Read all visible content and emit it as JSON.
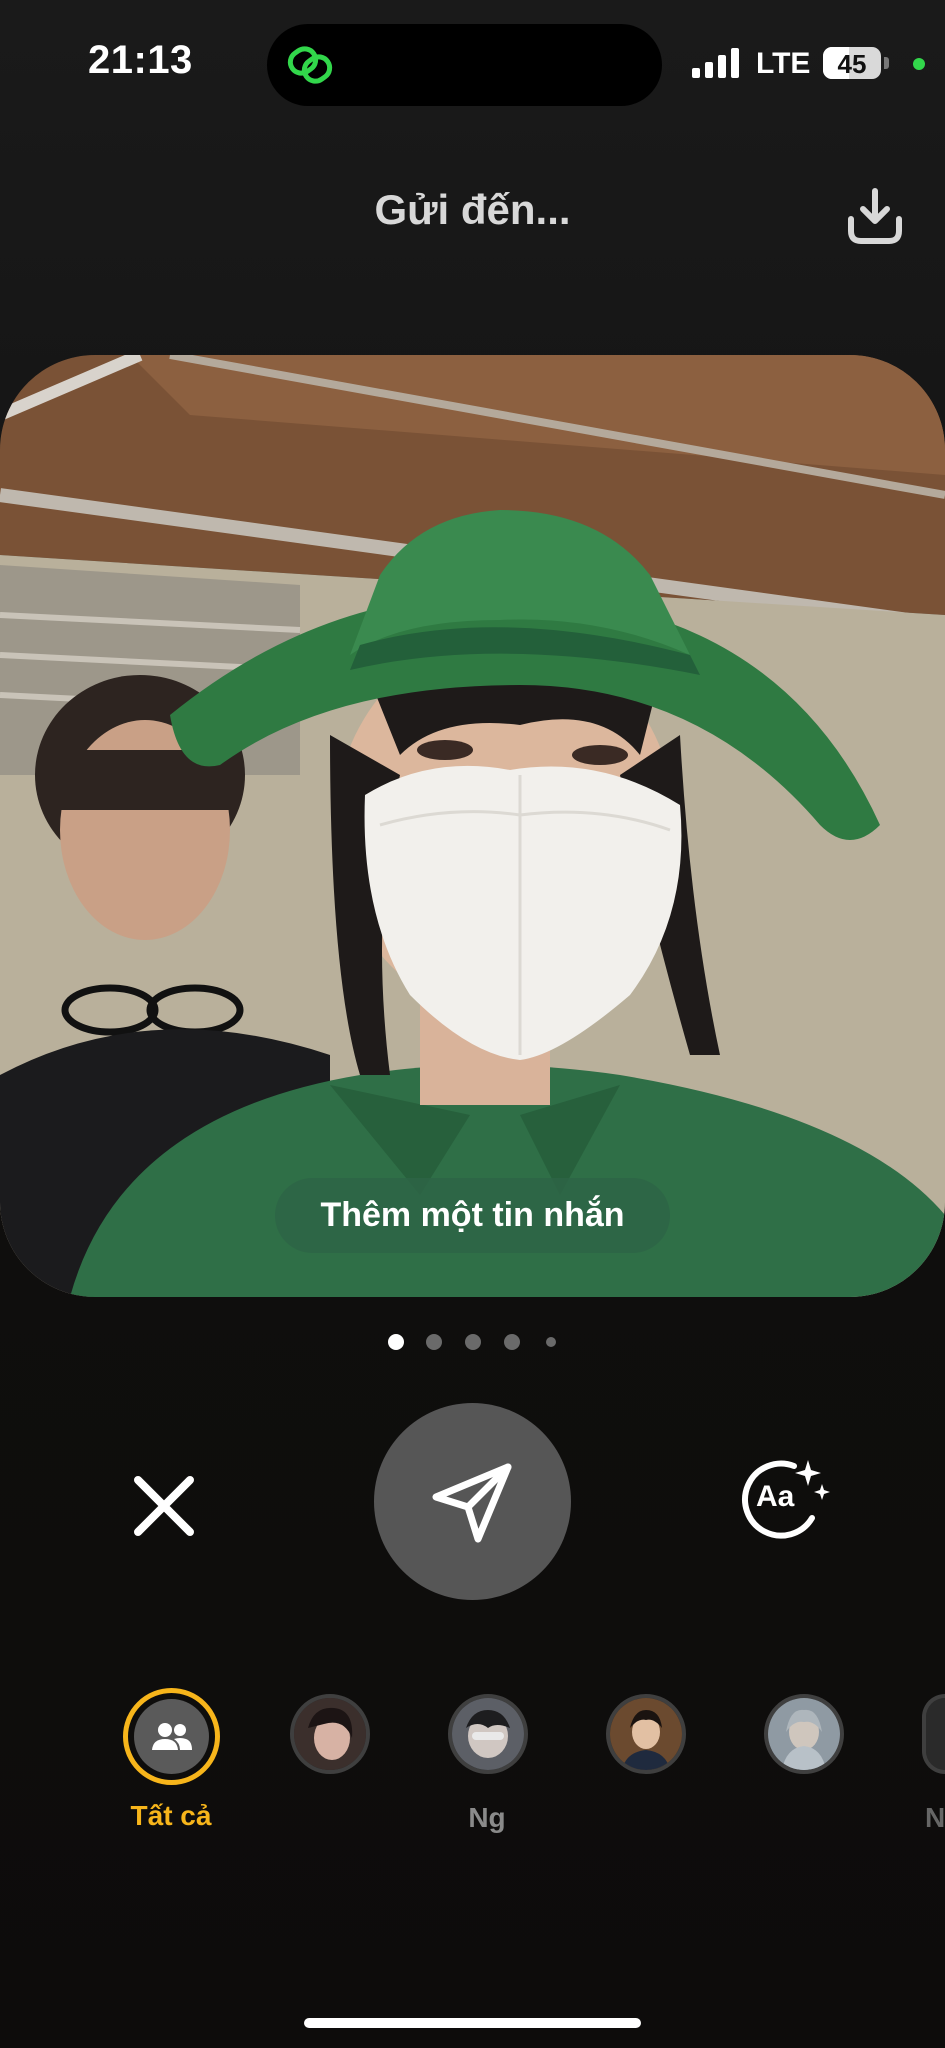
{
  "status_bar": {
    "time": "21:13",
    "network": "LTE",
    "battery_level": "45",
    "battery_fraction": 0.45,
    "island_icon": "link-chain-icon"
  },
  "header": {
    "title": "Gửi đến...",
    "download_icon": "download-icon"
  },
  "photo": {
    "message_placeholder": "Thêm một tin nhắn"
  },
  "pagination": {
    "total": 5,
    "active_index": 0
  },
  "controls": {
    "close_icon": "close-icon",
    "send_icon": "send-icon",
    "text_style_icon": "text-style-sparkle-icon",
    "text_style_glyph": "Aa"
  },
  "recipients": [
    {
      "label": "Tất cả",
      "selected": true,
      "icon": "group-icon"
    },
    {
      "label": "",
      "selected": false
    },
    {
      "label": "Ng",
      "selected": false
    },
    {
      "label": "",
      "selected": false
    },
    {
      "label": "",
      "selected": false
    },
    {
      "label": "N",
      "selected": false
    }
  ],
  "colors": {
    "accent": "#f7b51b",
    "send_button": "#565656",
    "message_pill": "#2d6446",
    "status_green": "#32d74b"
  }
}
